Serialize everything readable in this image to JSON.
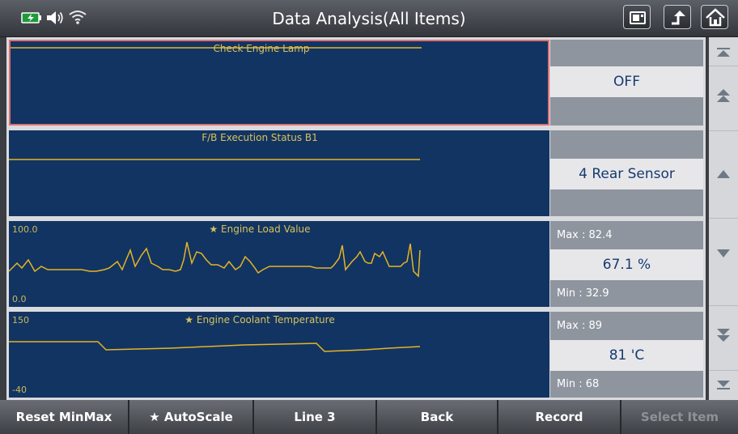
{
  "header": {
    "title": "Data Analysis(All Items)",
    "status_icons": [
      "battery-icon",
      "speaker-icon",
      "wifi-icon"
    ],
    "buttons": [
      "screenshot-icon",
      "up-arrow-icon",
      "home-icon"
    ]
  },
  "panels": [
    {
      "name": "Check Engine Lamp",
      "value": "OFF"
    },
    {
      "name": "F/B Execution Status B1",
      "value": "4 Rear Sensor"
    },
    {
      "name": "★ Engine Load Value",
      "value": "67.1 %",
      "max_label": "Max :",
      "max": "82.4",
      "min_label": "Min :",
      "min": "32.9",
      "axis_top": "100.0",
      "axis_bottom": "0.0"
    },
    {
      "name": "★ Engine Coolant Temperature",
      "value": "81 'C",
      "max_label": "Max :",
      "max": "89",
      "min_label": "Min :",
      "min": "68",
      "axis_top": "150",
      "axis_bottom": "-40"
    }
  ],
  "scrollbar": [
    "scroll-top-icon",
    "page-up-icon",
    "scroll-up-icon",
    "scroll-down-icon",
    "page-down-icon",
    "scroll-bottom-icon"
  ],
  "toolbar": {
    "reset": "Reset MinMax",
    "autoscale": "★ AutoScale",
    "line": "Line 3",
    "back": "Back",
    "record": "Record",
    "select": "Select Item"
  },
  "colors": {
    "graph_bg": "#123463",
    "trace": "#e6b422",
    "selection": "#e07070",
    "value_text": "#163b70"
  }
}
